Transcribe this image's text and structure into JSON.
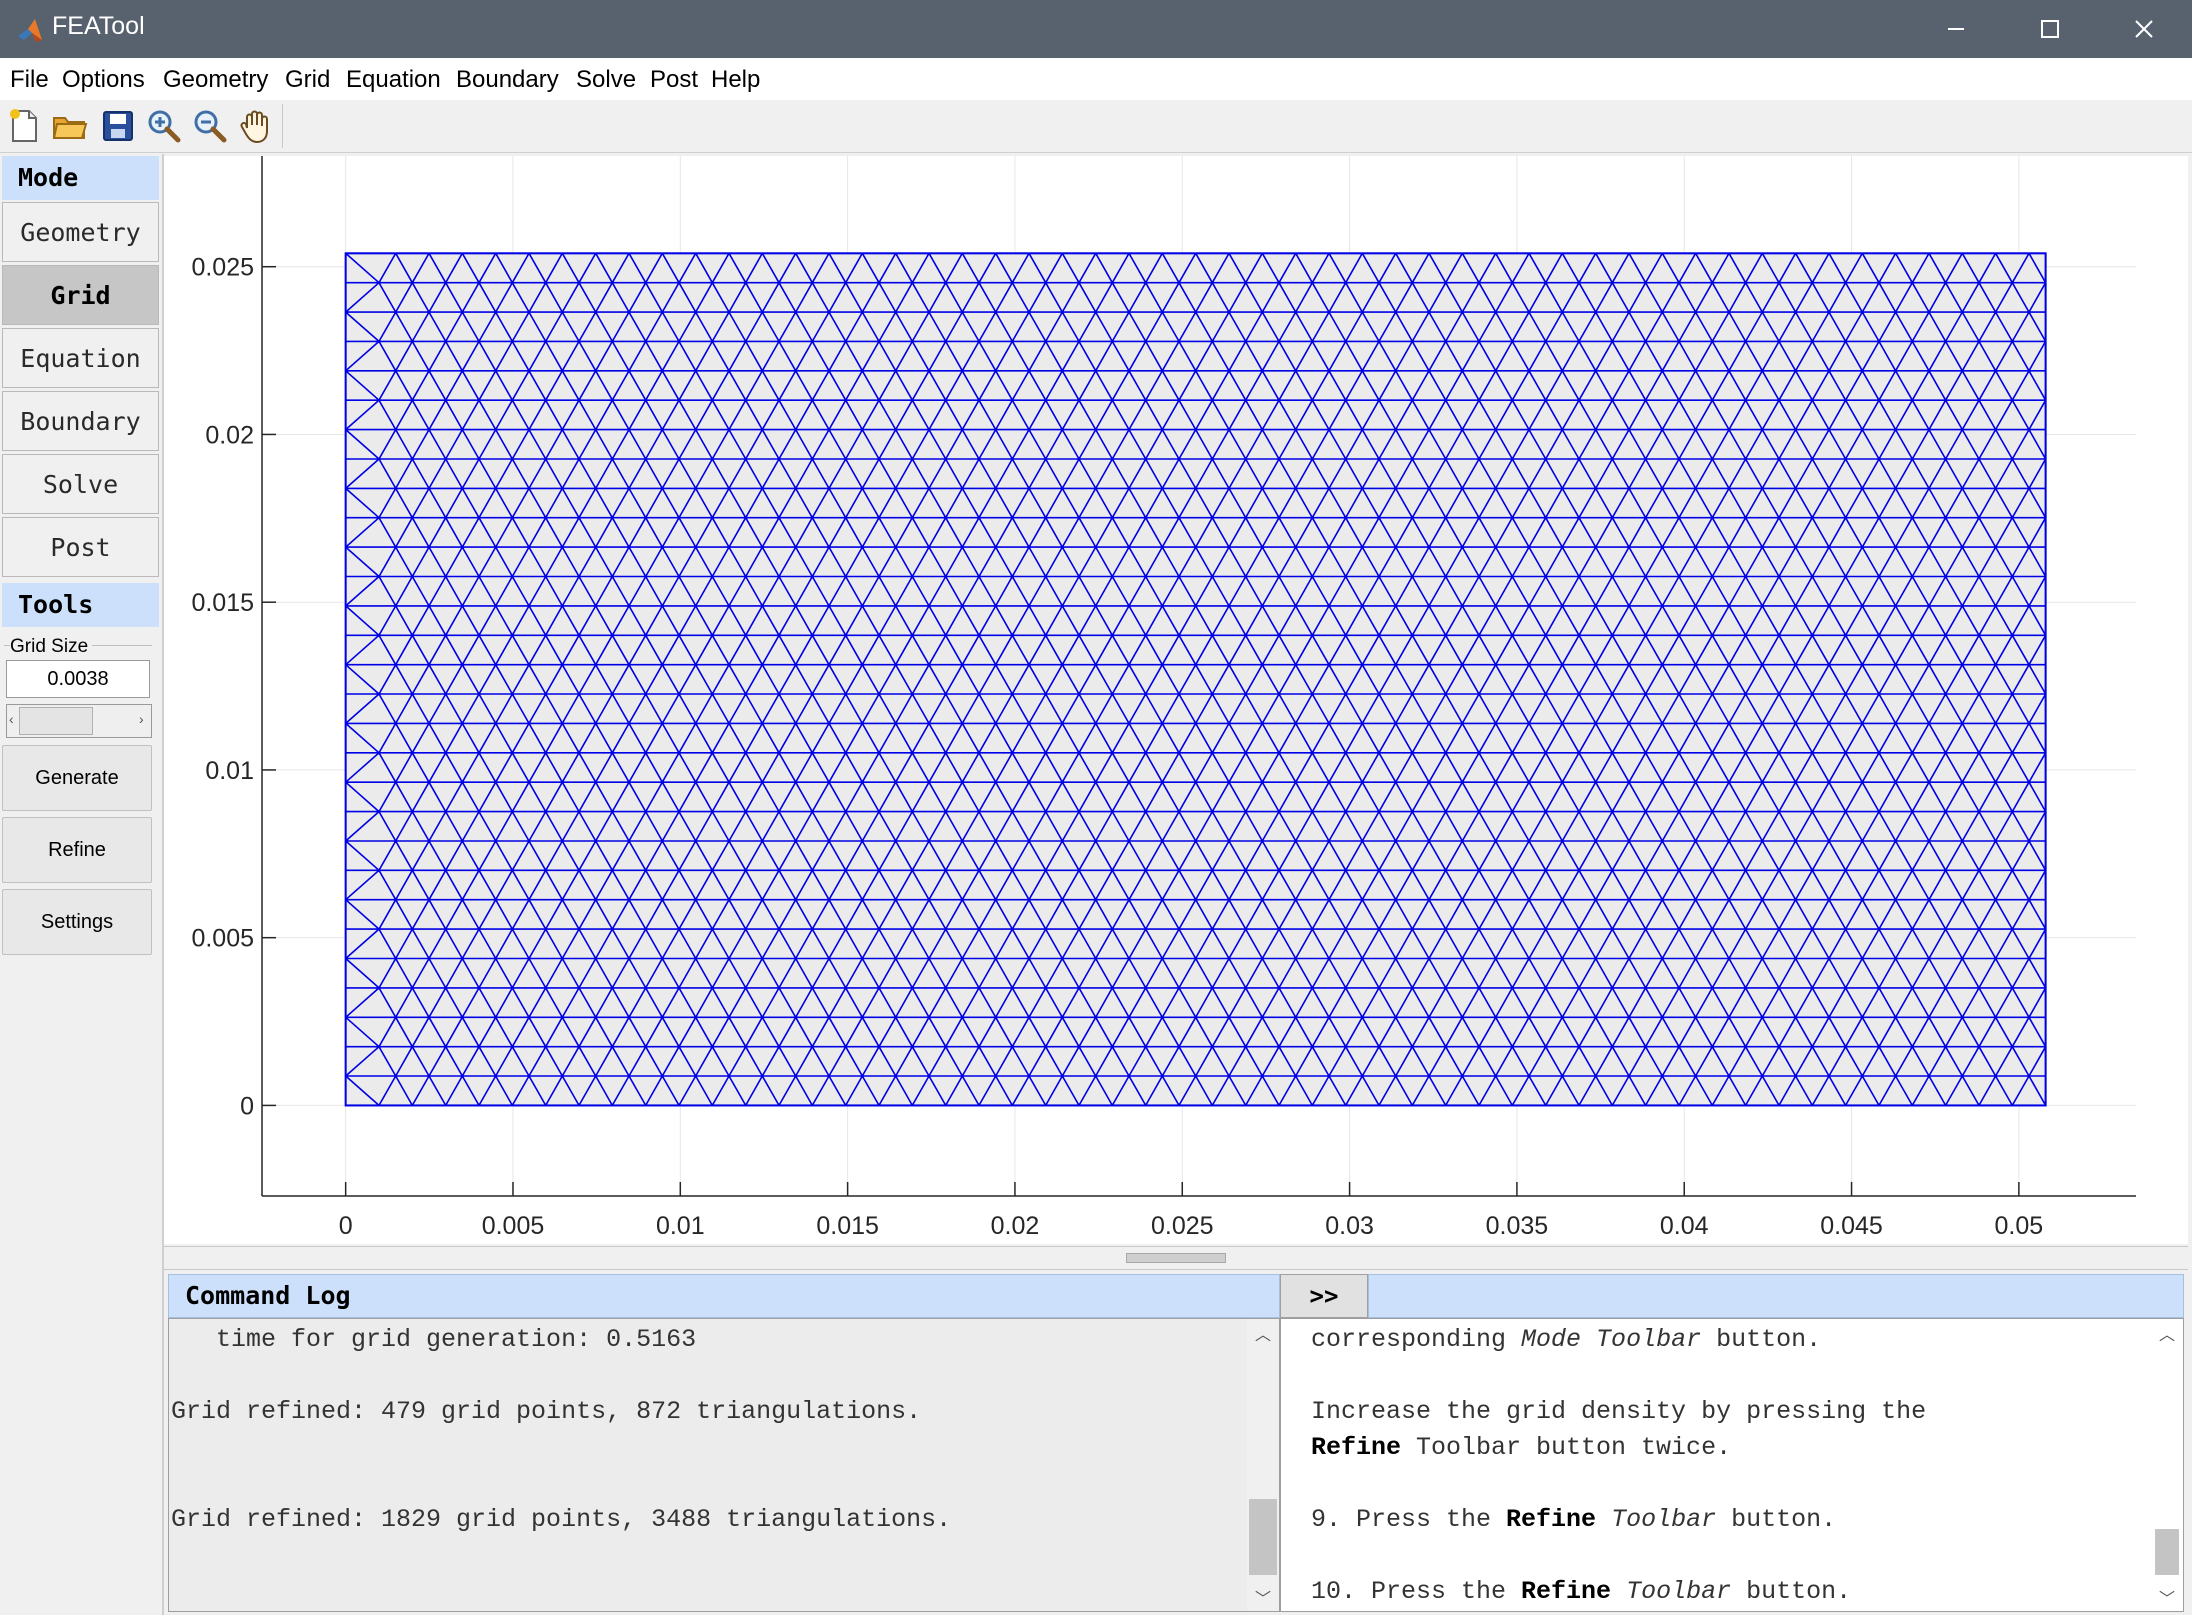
{
  "window": {
    "title": "FEATool",
    "minimize_glyph": "─",
    "maximize_glyph": "☐",
    "close_glyph": "✕"
  },
  "menu": [
    "File",
    "Options",
    "Geometry",
    "Grid",
    "Equation",
    "Boundary",
    "Solve",
    "Post",
    "Help"
  ],
  "toolbar": {
    "icons": [
      "new-file-icon",
      "open-folder-icon",
      "save-icon",
      "zoom-in-icon",
      "zoom-out-icon",
      "pan-hand-icon"
    ]
  },
  "sidebar": {
    "mode_header": "Mode",
    "modes": [
      {
        "label": "Geometry",
        "active": false
      },
      {
        "label": "Grid",
        "active": true
      },
      {
        "label": "Equation",
        "active": false
      },
      {
        "label": "Boundary",
        "active": false
      },
      {
        "label": "Solve",
        "active": false
      },
      {
        "label": "Post",
        "active": false
      }
    ],
    "tools_header": "Tools",
    "grid_size_label": "Grid Size",
    "grid_size_value": "0.0038",
    "buttons": [
      "Generate",
      "Refine",
      "Settings"
    ]
  },
  "plot": {
    "x_ticks": [
      "0",
      "0.005",
      "0.01",
      "0.015",
      "0.02",
      "0.025",
      "0.03",
      "0.035",
      "0.04",
      "0.045",
      "0.05"
    ],
    "y_ticks": [
      "0",
      "0.005",
      "0.01",
      "0.015",
      "0.02",
      "0.025"
    ],
    "x_range": [
      -0.0025,
      0.0535
    ],
    "y_range": [
      -0.0027,
      0.0283
    ],
    "domain": {
      "x": [
        0,
        0.0508
      ],
      "y": [
        0,
        0.0254
      ]
    },
    "mesh_color": "#0000e6",
    "fill_color": "#ebebeb",
    "grid": true
  },
  "command_log": {
    "header": "Command Log",
    "lines": [
      "   time for grid generation: 0.5163",
      "",
      "Grid refined: 479 grid points, 872 triangulations.",
      "",
      "",
      "Grid refined: 1829 grid points, 3488 triangulations."
    ]
  },
  "help_panel": {
    "expand_label": ">>",
    "line1_prefix": "corresponding ",
    "line1_em": "Mode Toolbar",
    "line1_suffix": " button.",
    "line2": "Increase the grid density by pressing the",
    "line3_bold": "Refine",
    "line3_suffix": " Toolbar button twice.",
    "step9_prefix": "9. Press the ",
    "step9_bold": "Refine",
    "step9_em": "Toolbar",
    "step9_suffix": " button.",
    "step10_prefix": "10. Press the ",
    "step10_bold": "Refine",
    "step10_em": "Toolbar",
    "step10_suffix": " button."
  }
}
